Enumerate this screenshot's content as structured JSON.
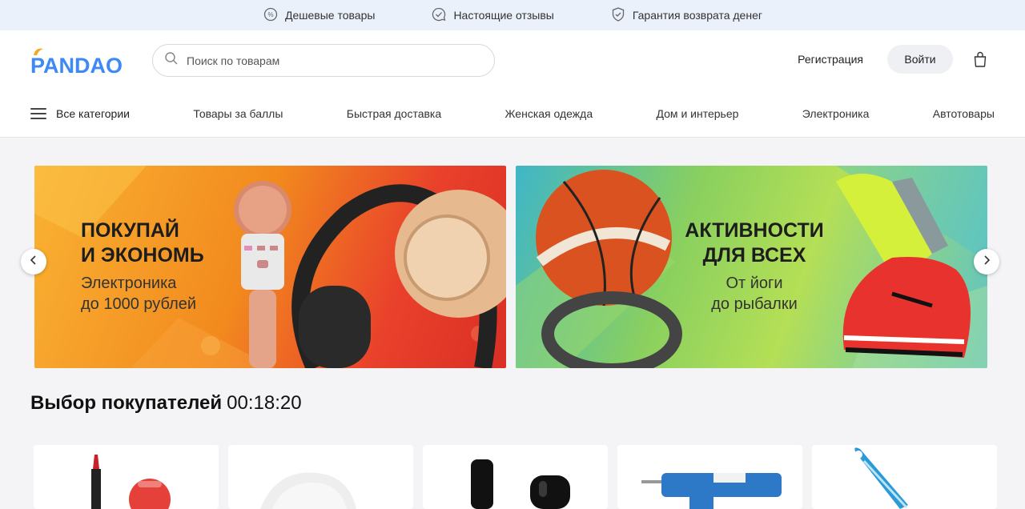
{
  "topbar": {
    "perks": [
      {
        "icon": "discount-icon",
        "label": "Дешевые товары"
      },
      {
        "icon": "check-chat-icon",
        "label": "Настоящие отзывы"
      },
      {
        "icon": "shield-check-icon",
        "label": "Гарантия возврата денег"
      }
    ]
  },
  "header": {
    "logo_text": "PANDAO",
    "search_placeholder": "Поиск по товарам",
    "register_label": "Регистрация",
    "login_label": "Войти",
    "cart_icon": "bag-icon"
  },
  "nav": {
    "all_label": "Все категории",
    "links": [
      "Товары за баллы",
      "Быстрая доставка",
      "Женская одежда",
      "Дом и интерьер",
      "Электроника",
      "Автотовары"
    ]
  },
  "banners": [
    {
      "title_line1": "Покупай",
      "title_line2": "и экономь",
      "sub_line1": "Электроника",
      "sub_line2": "до 1000 рублей"
    },
    {
      "title_line1": "Активности",
      "title_line2": "для всех",
      "sub_line1": "От йоги",
      "sub_line2": "до рыбалки"
    }
  ],
  "section": {
    "title": "Выбор покупателей",
    "timer": "00:18:20"
  },
  "colors": {
    "brand_blue": "#3d8af7",
    "brand_orange": "#f5a623",
    "topbar_bg": "#eaf1fb"
  }
}
